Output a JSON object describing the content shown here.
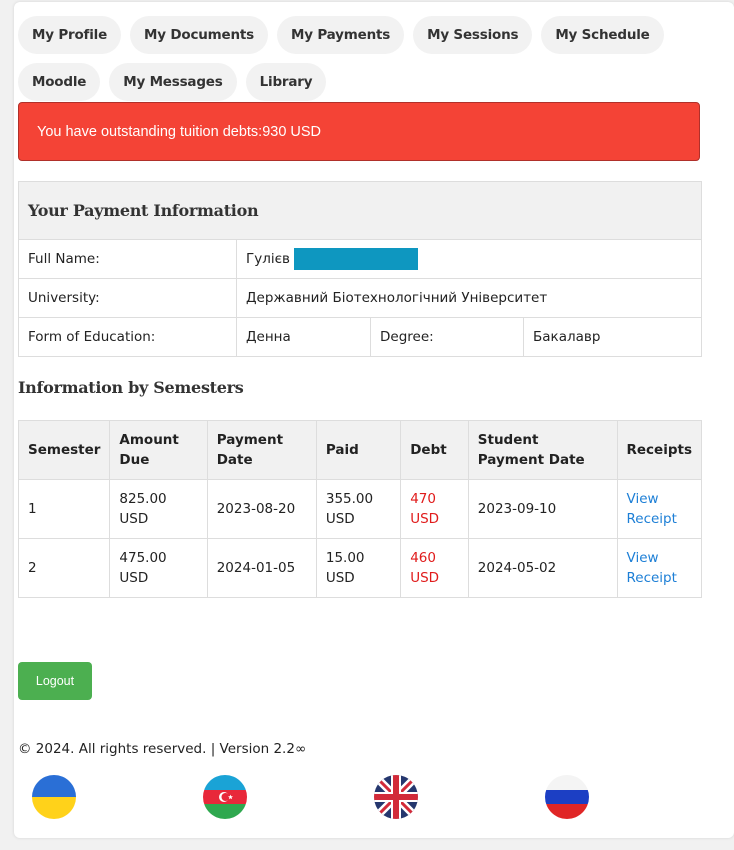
{
  "nav": [
    "My Profile",
    "My Documents",
    "My Payments",
    "My Sessions",
    "My Schedule",
    "Moodle",
    "My Messages",
    "Library"
  ],
  "alert": "You have outstanding tuition debts:930 USD",
  "payment_info": {
    "title": "Your Payment Information",
    "full_name_label": "Full Name:",
    "full_name_value": "Гулієв",
    "university_label": "University:",
    "university_value": "Державний Біотехнологічний Університет",
    "form_label": "Form of Education:",
    "form_value": "Денна",
    "degree_label": "Degree:",
    "degree_value": "Бакалавр"
  },
  "semesters": {
    "title": "Information by Semesters",
    "headers": [
      "Semester",
      "Amount Due",
      "Payment Date",
      "Paid",
      "Debt",
      "Student Payment Date",
      "Receipts"
    ],
    "rows": [
      {
        "semester": "1",
        "amount_due": "825.00 USD",
        "payment_date": "2023-08-20",
        "paid": "355.00 USD",
        "debt": "470 USD",
        "student_payment_date": "2023-09-10",
        "receipt": "View Receipt"
      },
      {
        "semester": "2",
        "amount_due": "475.00 USD",
        "payment_date": "2024-01-05",
        "paid": "15.00 USD",
        "debt": "460 USD",
        "student_payment_date": "2024-05-02",
        "receipt": "View Receipt"
      }
    ]
  },
  "logout_label": "Logout",
  "footer": "© 2024. All rights reserved.  | Version 2.2∞",
  "languages": [
    "ukraine-flag-icon",
    "azerbaijan-flag-icon",
    "uk-flag-icon",
    "russia-flag-icon"
  ],
  "colors": {
    "alert": "#f44336",
    "logout": "#4caf50",
    "link": "#1d7fd6",
    "debt": "#e01b1b",
    "redaction": "#0e97c0"
  }
}
